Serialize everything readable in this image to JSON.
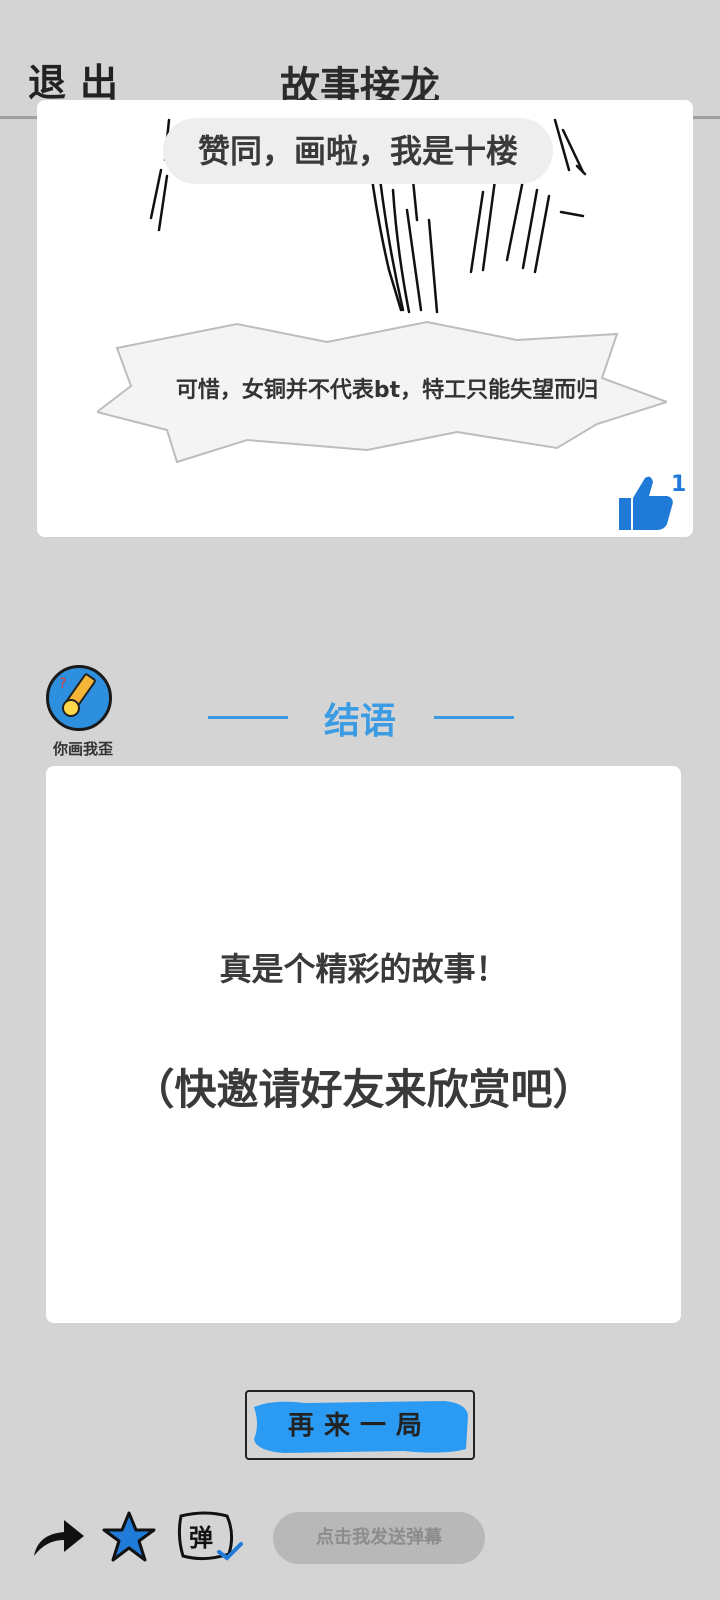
{
  "header": {
    "exit_label": "退出",
    "title": "故事接龙"
  },
  "story": {
    "caption_top": "赞同，画啦，我是十楼",
    "caption_bottom": "可惜，女铜并不代表bt，特工只能失望而归",
    "like_count": "1"
  },
  "app": {
    "name": "你画我歪"
  },
  "epilogue": {
    "title": "结语",
    "line1": "真是个精彩的故事！",
    "line2": "（快邀请好友来欣赏吧）"
  },
  "actions": {
    "play_again": "再来一局",
    "danmaku_placeholder": "点击我发送弹幕",
    "danmaku_icon_char": "弹"
  },
  "colors": {
    "accent_blue": "#3b9be3",
    "like_blue": "#1f7ad8",
    "background": "#d4d4d4"
  },
  "icons": [
    "share-arrow-icon",
    "star-icon",
    "danmaku-icon",
    "thumbs-up-icon"
  ]
}
